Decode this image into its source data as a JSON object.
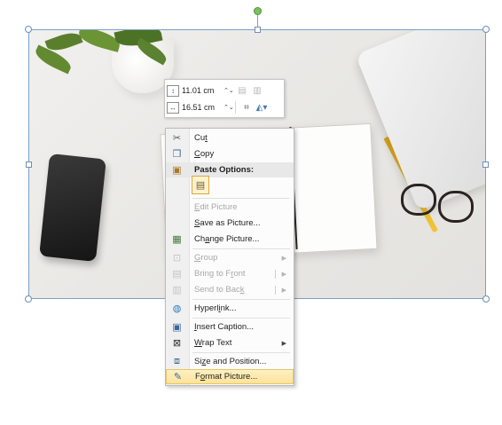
{
  "toolbar": {
    "height": "11.01 cm",
    "width": "16.51 cm",
    "spin_glyph": "⌃⌄",
    "icons": [
      "shape-height-icon",
      "shape-width-icon",
      "bring-forward-icon",
      "send-backward-icon",
      "crop-icon",
      "color-fill-icon"
    ]
  },
  "menu": {
    "cut": {
      "pre": "Cu",
      "key": "t",
      "post": ""
    },
    "copy": {
      "pre": "",
      "key": "C",
      "post": "opy"
    },
    "paste_options": "Paste Options:",
    "edit_picture": {
      "pre": "",
      "key": "E",
      "post": "dit Picture"
    },
    "save_as_picture": {
      "pre": "",
      "key": "S",
      "post": "ave as Picture..."
    },
    "change_picture": {
      "pre": "Ch",
      "key": "a",
      "post": "nge Picture..."
    },
    "group": {
      "pre": "",
      "key": "G",
      "post": "roup"
    },
    "bring_to_front": {
      "pre": "Bring to F",
      "key": "r",
      "post": "ont"
    },
    "send_to_back": {
      "pre": "Send to Bac",
      "key": "k",
      "post": ""
    },
    "hyperlink": {
      "pre": "Hyperl",
      "key": "i",
      "post": "nk..."
    },
    "insert_caption": {
      "pre": "",
      "key": "I",
      "post": "nsert Caption..."
    },
    "wrap_text": {
      "pre": "",
      "key": "W",
      "post": "rap Text"
    },
    "size_and_position": {
      "pre": "Si",
      "key": "z",
      "post": "e and Position..."
    },
    "format_picture": {
      "pre": "F",
      "key": "o",
      "post": "rmat Picture..."
    }
  },
  "colors": {
    "highlight": "#fbe39a",
    "selection_border": "#7aa0c8",
    "rotate_handle": "#78c35a"
  }
}
